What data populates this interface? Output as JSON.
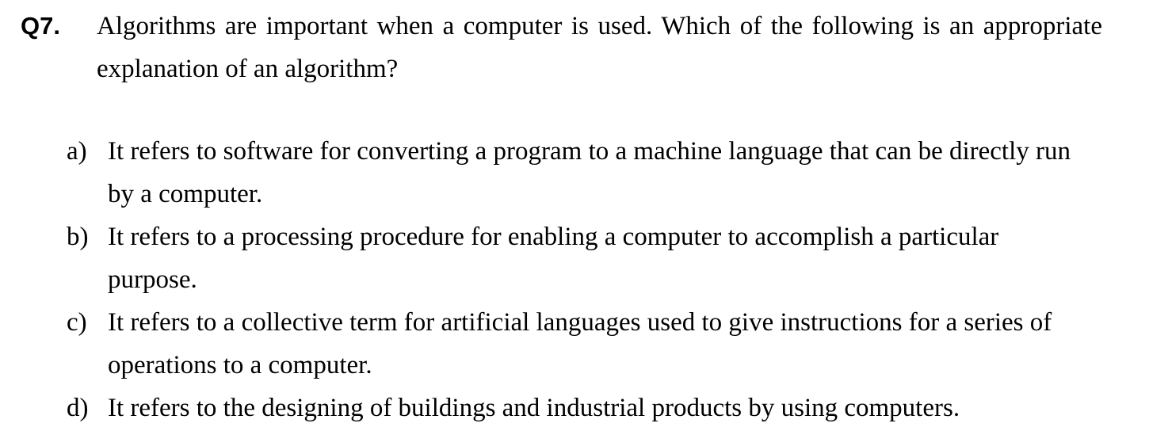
{
  "question": {
    "number": "Q7.",
    "text": "Algorithms are important when a computer is used. Which of the following is an appropriate explanation of an algorithm?"
  },
  "options": [
    {
      "letter": "a)",
      "text": "It refers to software for converting a program to a machine language that can be directly run by a computer."
    },
    {
      "letter": "b)",
      "text": "It refers to a processing procedure for enabling a computer to accomplish a particular purpose."
    },
    {
      "letter": "c)",
      "text": "It refers to a collective term for artificial languages used to give instructions for a series of operations to a computer."
    },
    {
      "letter": "d)",
      "text": "It refers to the designing of buildings and industrial products by using computers."
    }
  ]
}
